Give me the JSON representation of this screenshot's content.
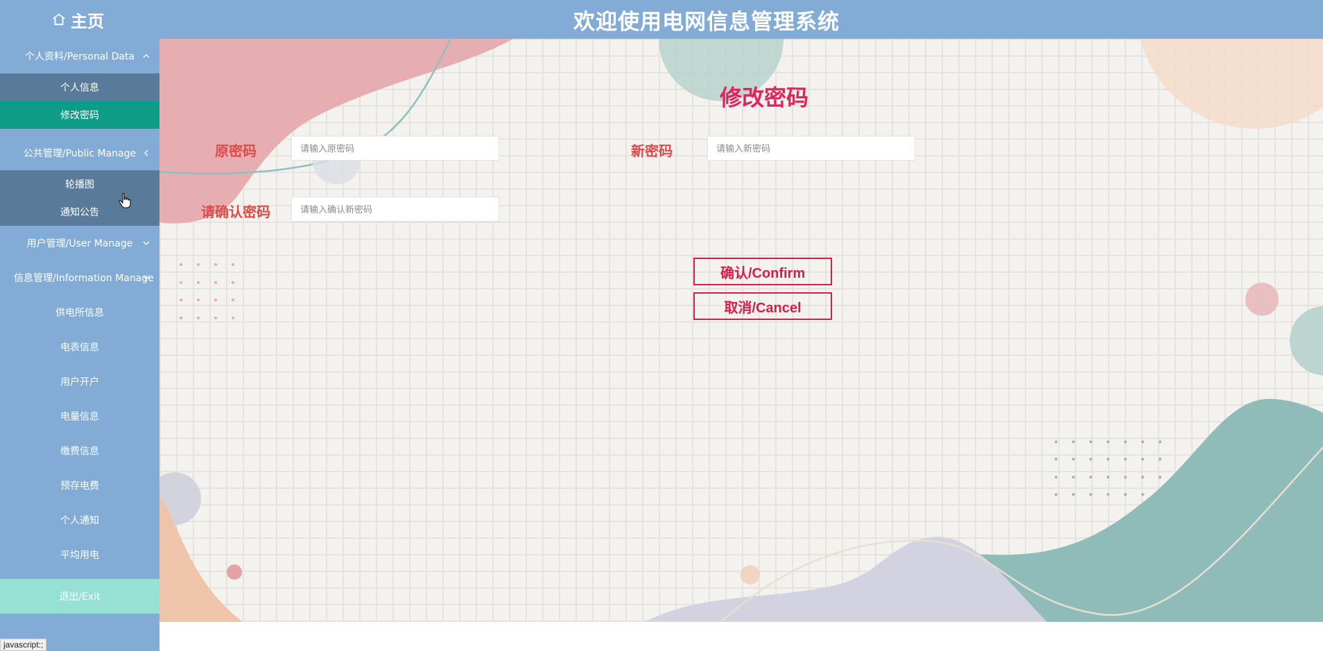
{
  "header": {
    "home_label": "主页",
    "title": "欢迎使用电网信息管理系统"
  },
  "sidebar": {
    "groups": [
      {
        "label": "个人资料/Personal Data",
        "expanded": true,
        "items": [
          {
            "label": "个人信息"
          },
          {
            "label": "修改密码",
            "active": true
          }
        ]
      },
      {
        "label": "公共管理/Public Manage",
        "expanded": true,
        "items": [
          {
            "label": "轮播图"
          },
          {
            "label": "通知公告"
          }
        ]
      },
      {
        "label": "用户管理/User Manage",
        "expanded": false
      },
      {
        "label": "信息管理/Information Manage",
        "expanded": false
      }
    ],
    "items": [
      {
        "label": "供电所信息"
      },
      {
        "label": "电表信息"
      },
      {
        "label": "用户开户"
      },
      {
        "label": "电量信息"
      },
      {
        "label": "缴费信息"
      },
      {
        "label": "预存电费"
      },
      {
        "label": "个人通知"
      },
      {
        "label": "平均用电"
      }
    ],
    "exit_label": "退出/Exit",
    "status_text": "javascript:;"
  },
  "form": {
    "title": "修改密码",
    "old_password": {
      "label": "原密码",
      "placeholder": "请输入原密码",
      "value": ""
    },
    "new_password": {
      "label": "新密码",
      "placeholder": "请输入新密码",
      "value": ""
    },
    "confirm_password": {
      "label": "请确认密码",
      "placeholder": "请输入确认新密码",
      "value": ""
    },
    "confirm_button": "确认/Confirm",
    "cancel_button": "取消/Cancel"
  },
  "colors": {
    "header_bg": "#82acd6",
    "sidebar_bg": "#82acd6",
    "submenu_bg": "#5a7a99",
    "active_bg": "#0c9c88",
    "exit_bg": "#97e1d4",
    "accent_red": "#e0245e",
    "label_red": "#dd4a4a"
  },
  "icons": {
    "home": "home-icon",
    "chevron_up": "chevron-up-icon",
    "chevron_left": "chevron-left-icon",
    "chevron_down": "chevron-down-icon",
    "cursor": "hand-pointer-icon"
  }
}
